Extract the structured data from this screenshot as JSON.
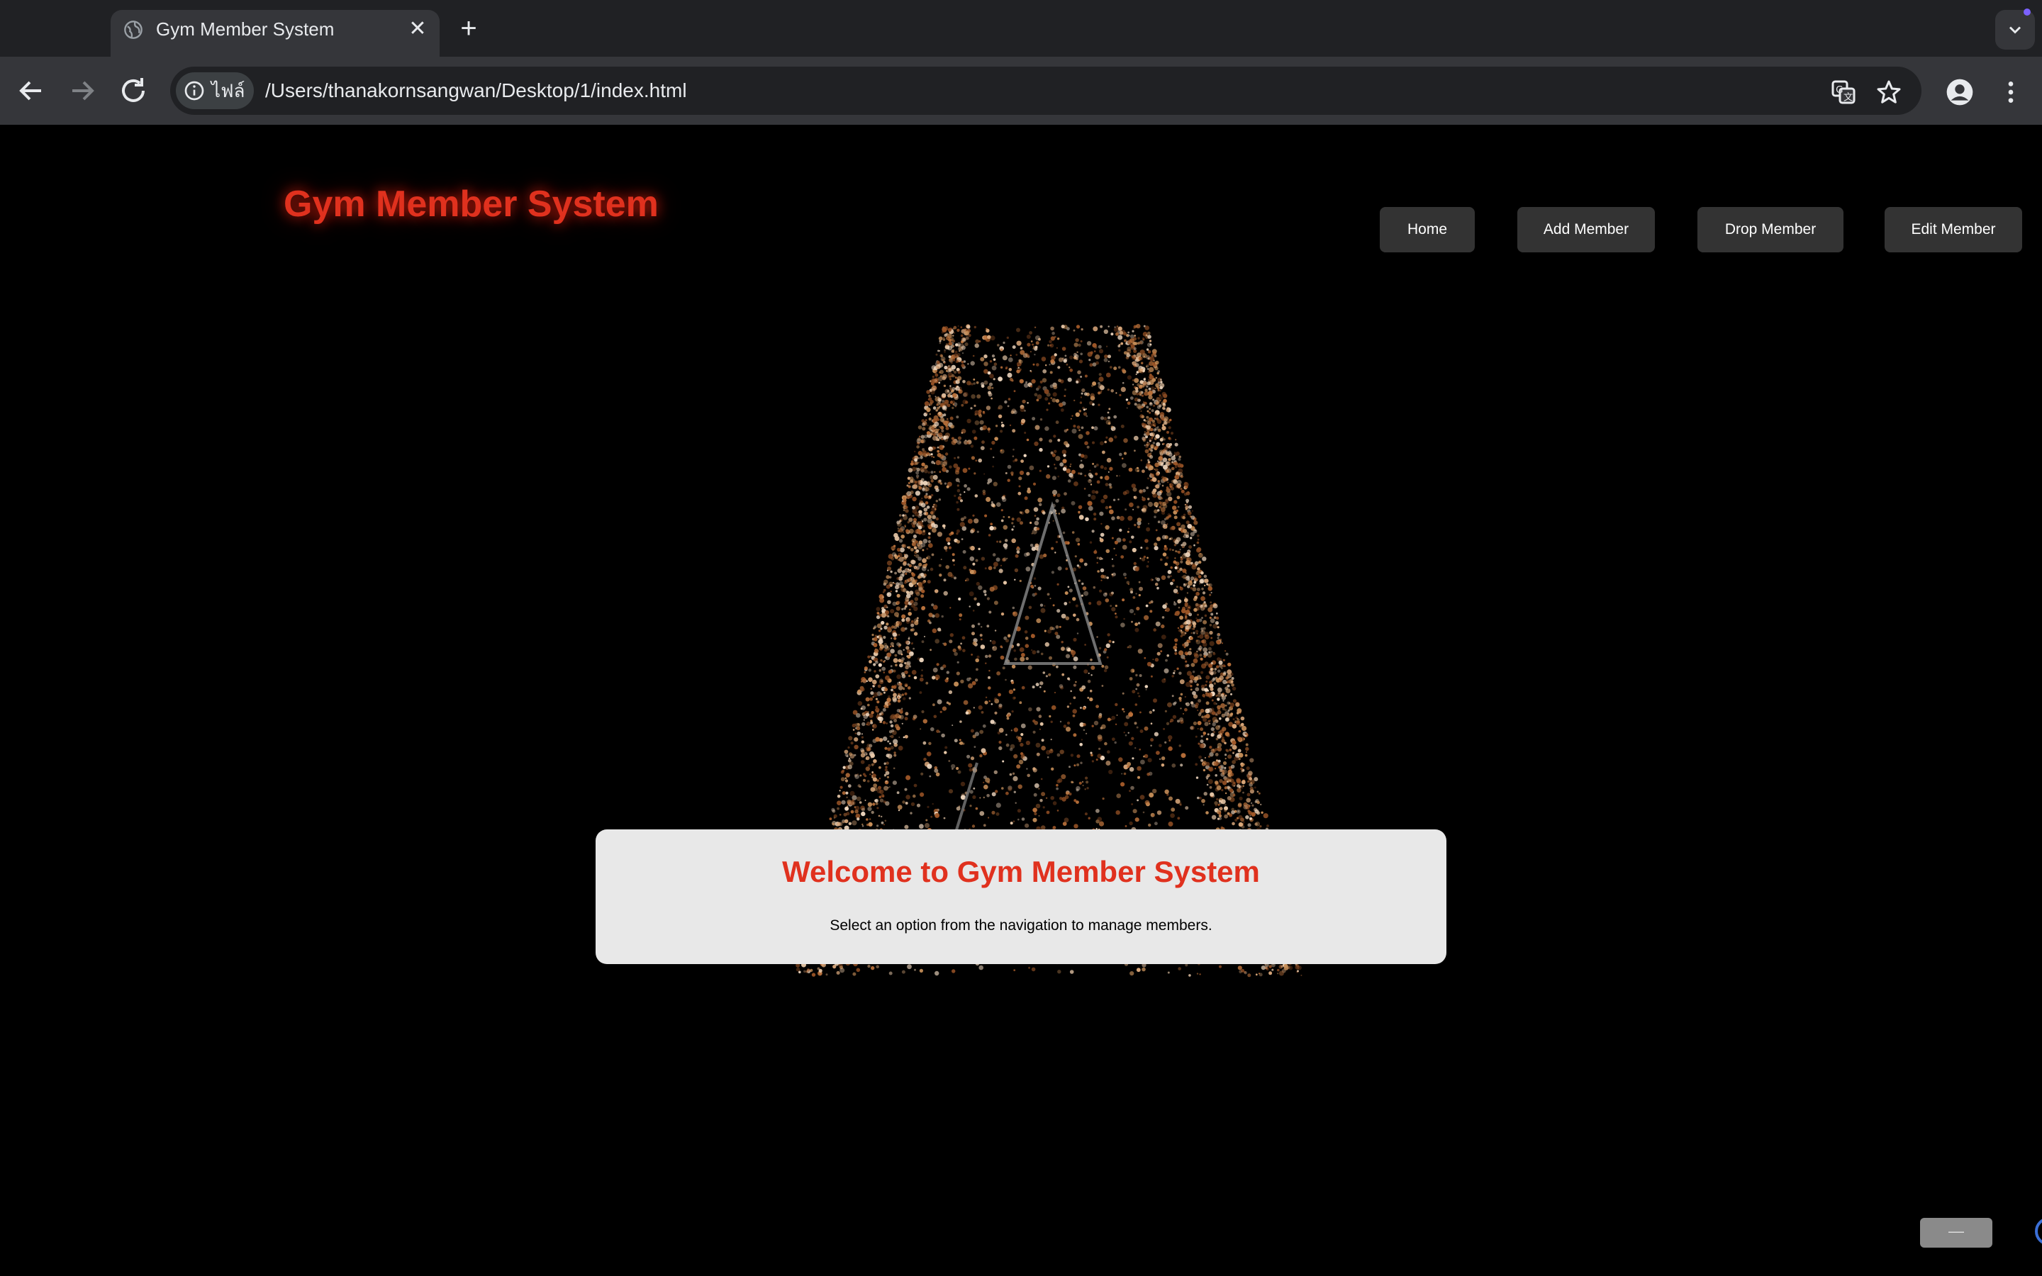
{
  "browser": {
    "tab_title": "Gym Member System",
    "new_tab_symbol": "+",
    "close_symbol": "✕",
    "site_chip_label": "ไฟล์",
    "url": "/Users/thanakornsangwan/Desktop/1/index.html",
    "icons": [
      "globe-icon",
      "back-icon",
      "forward-icon",
      "reload-icon",
      "info-icon",
      "translate-icon",
      "star-icon",
      "profile-icon",
      "menu-icon",
      "tab-search-icon"
    ]
  },
  "page": {
    "site_title": "Gym Member System",
    "nav": {
      "home": "Home",
      "add": "Add Member",
      "drop": "Drop Member",
      "edit": "Edit Member"
    },
    "welcome": {
      "title": "Welcome to Gym Member System",
      "subtitle": "Select an option from the navigation to manage members."
    },
    "floating_pill": "—"
  },
  "colors": {
    "accent": "#e0311e",
    "background": "#000000",
    "nav_button": "#333333",
    "card": "#e8e8e8",
    "particle": "#c8905a"
  }
}
